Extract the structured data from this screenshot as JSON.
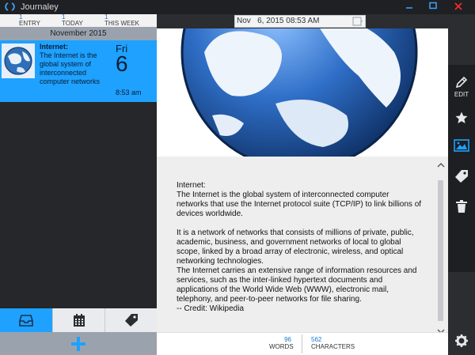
{
  "window": {
    "title": "Journaley"
  },
  "stats": [
    {
      "value": "1",
      "label": "ENTRY"
    },
    {
      "value": "1",
      "label": "TODAY"
    },
    {
      "value": "1",
      "label": "THIS WEEK"
    }
  ],
  "month_header": "November 2015",
  "entry": {
    "title": "Internet:",
    "preview": "The Internet is the global system of interconnected computer networks t...",
    "day": "Fri",
    "date": "6",
    "time": "8:53 am"
  },
  "date_field": {
    "value": "Nov   6, 2015 08:53 AM"
  },
  "body": {
    "p1": "Internet:\nThe Internet is the global system of interconnected computer networks that use the Internet protocol suite (TCP/IP) to link billions of devices worldwide.",
    "p2": "It is a network of networks that consists of millions of private, public, academic, business, and government networks of local to global scope, linked by a broad array of electronic, wireless, and optical networking technologies.\nThe Internet carries an extensive range of information resources and services, such as the inter-linked hypertext documents and applications of the World Wide Web (WWW), electronic mail, telephony, and peer-to-peer networks for file sharing.\n-- Credit: Wikipedia"
  },
  "counts": {
    "words": {
      "value": "96",
      "label": "WORDS"
    },
    "characters": {
      "value": "562",
      "label": "CHARACTERS"
    }
  },
  "toolbar": {
    "edit_label": "EDIT"
  },
  "colors": {
    "accent": "#1ea1ff",
    "panel": "#25272a",
    "month_bar": "#9aa3ad"
  },
  "icons": [
    "journaley-logo-icon",
    "minimize-icon",
    "maximize-icon",
    "close-icon",
    "inbox-icon",
    "calendar-icon",
    "tag-icon",
    "add-icon",
    "calendar-picker-icon",
    "pencil-icon",
    "star-icon",
    "image-icon",
    "trash-icon",
    "gear-icon",
    "scroll-up-icon",
    "scroll-down-icon"
  ]
}
